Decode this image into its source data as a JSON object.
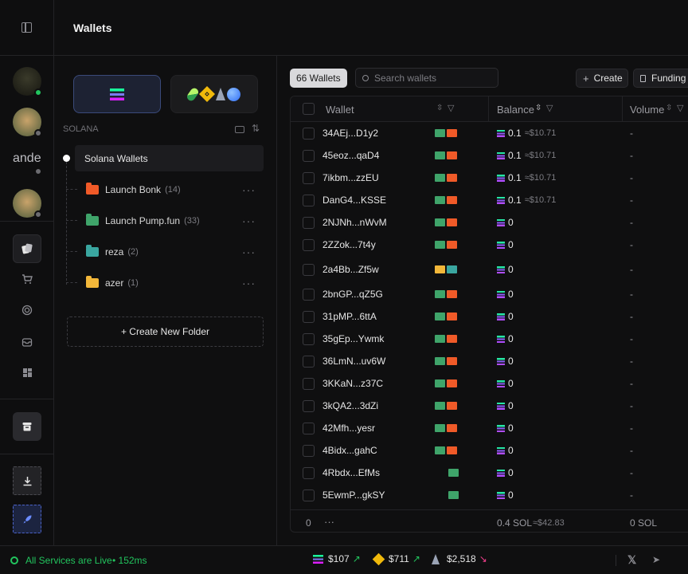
{
  "header": {
    "title": "Wallets"
  },
  "rail": {
    "avatars": [
      {
        "name": "avatar-1",
        "status": "#22c55e"
      },
      {
        "name": "avatar-2",
        "status": "#6b6b70"
      },
      {
        "name": "avatar-3",
        "text": "ande",
        "status": "#6b6b70"
      },
      {
        "name": "avatar-4",
        "status": "#6b6b70"
      }
    ]
  },
  "folders": {
    "network_label": "SOLANA",
    "root_label": "Solana Wallets",
    "items": [
      {
        "label": "Launch Bonk",
        "count": "(14)",
        "color": "#f05a28"
      },
      {
        "label": "Launch Pump.fun",
        "count": "(33)",
        "color": "#3fa46a"
      },
      {
        "label": "reza",
        "count": "(2)",
        "color": "#3aa6a0"
      },
      {
        "label": "azer",
        "count": "(1)",
        "color": "#f2b73a"
      }
    ],
    "create_label": "+ Create New Folder"
  },
  "toolbar": {
    "wallet_count": "66 Wallets",
    "search_placeholder": "Search wallets",
    "create_label": "Create",
    "funding_label": "Funding"
  },
  "table": {
    "columns": [
      "Wallet",
      "Balance",
      "Volume"
    ],
    "rows": [
      {
        "wallet": "34AEj...D1y2",
        "folders": [
          "green",
          "orange"
        ],
        "balance": "0.1",
        "usd": "≈$10.71",
        "volume": "-"
      },
      {
        "wallet": "45eoz...qaD4",
        "folders": [
          "green",
          "orange"
        ],
        "balance": "0.1",
        "usd": "≈$10.71",
        "volume": "-"
      },
      {
        "wallet": "7ikbm...zzEU",
        "folders": [
          "green",
          "orange"
        ],
        "balance": "0.1",
        "usd": "≈$10.71",
        "volume": "-"
      },
      {
        "wallet": "DanG4...KSSE",
        "folders": [
          "green",
          "orange"
        ],
        "balance": "0.1",
        "usd": "≈$10.71",
        "volume": "-"
      },
      {
        "wallet": "2NJNh...nWvM",
        "folders": [
          "green",
          "orange"
        ],
        "balance": "0",
        "usd": "",
        "volume": "-"
      },
      {
        "wallet": "2ZZok...7t4y",
        "folders": [
          "green",
          "orange"
        ],
        "balance": "0",
        "usd": "",
        "volume": "-"
      },
      {
        "wallet": "2a4Bb...Zf5w",
        "folders": [
          "yellow",
          "teal"
        ],
        "balance": "0",
        "usd": "",
        "volume": "-"
      },
      {
        "wallet": "2bnGP...qZ5G",
        "folders": [
          "green",
          "orange"
        ],
        "balance": "0",
        "usd": "",
        "volume": "-"
      },
      {
        "wallet": "31pMP...6ttA",
        "folders": [
          "green",
          "orange"
        ],
        "balance": "0",
        "usd": "",
        "volume": "-"
      },
      {
        "wallet": "35gEp...Ywmk",
        "folders": [
          "green",
          "orange"
        ],
        "balance": "0",
        "usd": "",
        "volume": "-"
      },
      {
        "wallet": "36LmN...uv6W",
        "folders": [
          "green",
          "orange"
        ],
        "balance": "0",
        "usd": "",
        "volume": "-"
      },
      {
        "wallet": "3KKaN...z37C",
        "folders": [
          "green",
          "orange"
        ],
        "balance": "0",
        "usd": "",
        "volume": "-"
      },
      {
        "wallet": "3kQA2...3dZi",
        "folders": [
          "green",
          "orange"
        ],
        "balance": "0",
        "usd": "",
        "volume": "-"
      },
      {
        "wallet": "42Mfh...yesr",
        "folders": [
          "green",
          "orange"
        ],
        "balance": "0",
        "usd": "",
        "volume": "-"
      },
      {
        "wallet": "4Bidx...gahC",
        "folders": [
          "green",
          "orange"
        ],
        "balance": "0",
        "usd": "",
        "volume": "-"
      },
      {
        "wallet": "4Rbdx...EfMs",
        "folders": [
          "green"
        ],
        "balance": "0",
        "usd": "",
        "volume": "-"
      },
      {
        "wallet": "5EwmP...gkSY",
        "folders": [
          "green"
        ],
        "balance": "0",
        "usd": "",
        "volume": "-"
      }
    ],
    "footer": {
      "selected": "0",
      "more": "···",
      "balance_total": "0.4 SOL",
      "usd_total": "≈$42.83",
      "volume_total": "0 SOL"
    }
  },
  "footer": {
    "status": "All Services are Live",
    "latency": "• 152ms",
    "prices": [
      {
        "coin": "sol",
        "value": "$107",
        "trend": "up"
      },
      {
        "coin": "bnb",
        "value": "$711",
        "trend": "up"
      },
      {
        "coin": "eth",
        "value": "$2,518",
        "trend": "down"
      }
    ]
  },
  "colors": {
    "green": "#3fa46a",
    "orange": "#f05a28",
    "teal": "#3aa6a0",
    "yellow": "#f2b73a",
    "up": "#22c55e",
    "down": "#f43f8e",
    "accent_live": "#22c55e"
  }
}
